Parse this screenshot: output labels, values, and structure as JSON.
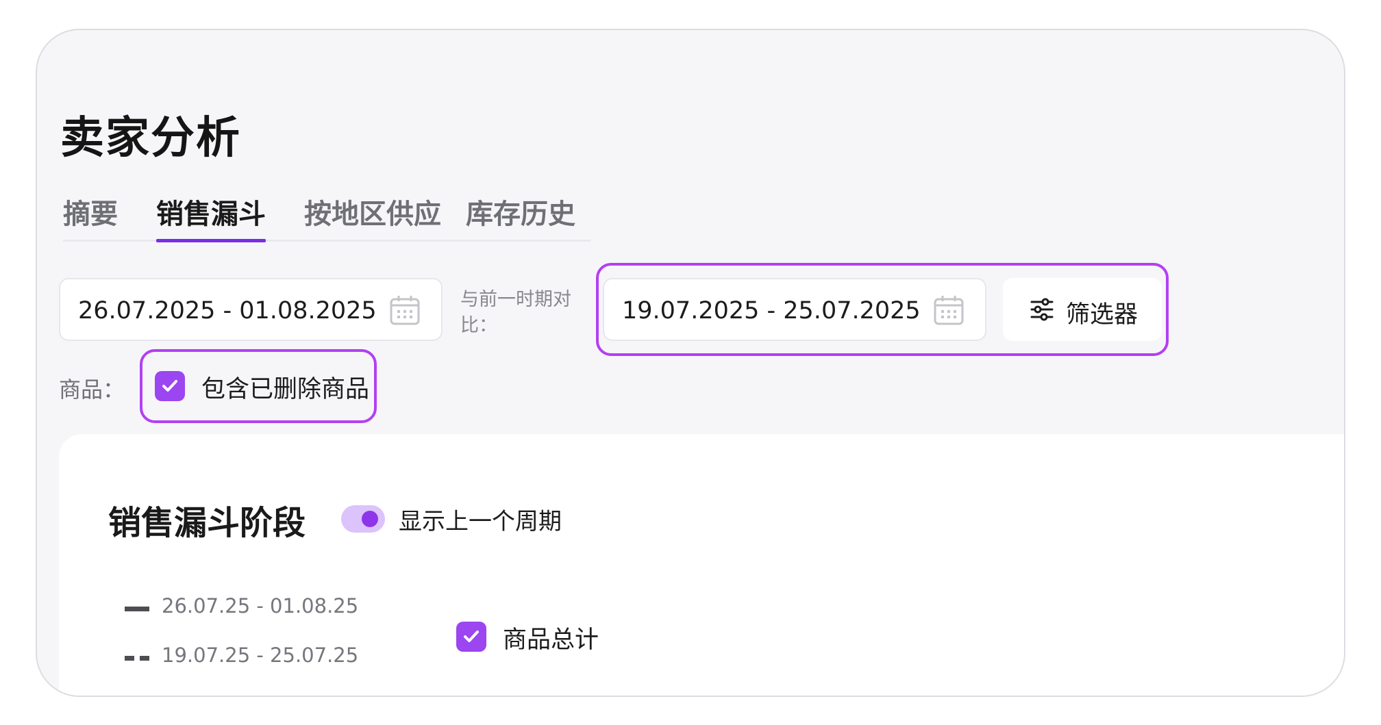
{
  "page": {
    "title": "卖家分析"
  },
  "tabs": [
    {
      "label": "摘要",
      "active": false
    },
    {
      "label": "销售漏斗",
      "active": true
    },
    {
      "label": "按地区供应",
      "active": false
    },
    {
      "label": "库存历史",
      "active": false
    }
  ],
  "filters": {
    "current_period": "26.07.2025 - 01.08.2025",
    "compare_label": "与前一时期对比：",
    "previous_period": "19.07.2025 - 25.07.2025",
    "filter_button_label": "筛选器",
    "goods_label": "商品：",
    "include_deleted_label": "包含已删除商品",
    "include_deleted_checked": true
  },
  "funnel": {
    "title": "销售漏斗阶段",
    "show_previous_label": "显示上一个周期",
    "show_previous_on": true,
    "legend": [
      {
        "label": "26.07.25 - 01.08.25",
        "style": "solid"
      },
      {
        "label": "19.07.25 - 25.07.25",
        "style": "dashed"
      }
    ],
    "total_goods_label": "商品总计",
    "total_goods_checked": true
  },
  "colors": {
    "accent": "#9b46f0",
    "highlight_border": "#b43ff2",
    "toggle_track": "#dcc3fb"
  }
}
